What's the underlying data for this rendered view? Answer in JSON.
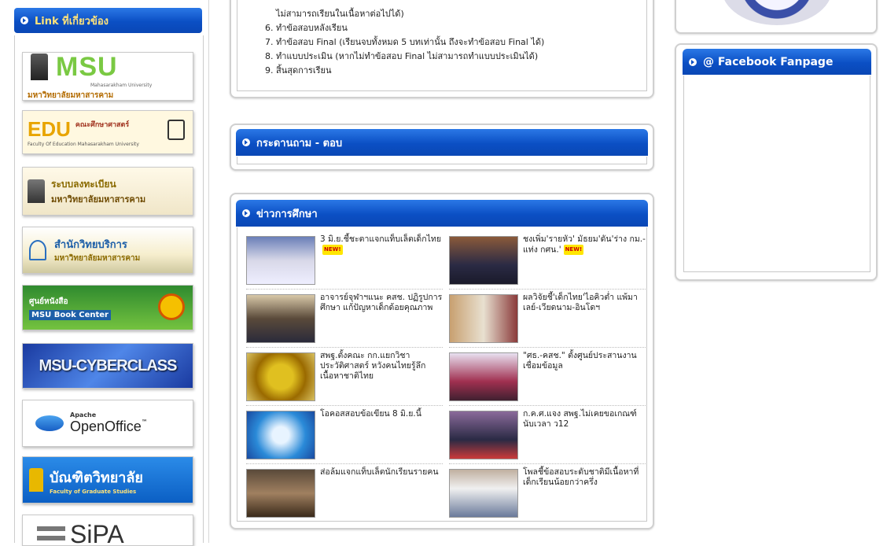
{
  "left": {
    "title": "Link ที่เกี่ยวข้อง",
    "banners": [
      {
        "name": "msu",
        "title": "MSU",
        "sub": "Mahasarakham University",
        "thai": "มหาวิทยาลัยมหาสารคาม"
      },
      {
        "name": "edu",
        "title": "EDU",
        "sub": "Faculty Of Education Mahasarakham University",
        "thai": "คณะศึกษาศาสตร์"
      },
      {
        "name": "registrar",
        "title": "ระบบลงทะเบียน",
        "thai": "มหาวิทยาลัยมหาสารคาม"
      },
      {
        "name": "computer-center",
        "title": "สำนักวิทยบริการ",
        "thai": "มหาวิทยาลัยมหาสารคาม"
      },
      {
        "name": "book-center",
        "title": "ศูนย์หนังสือ",
        "sub": "MSU Book Center"
      },
      {
        "name": "cyberclass",
        "title": "MSU-CYBERCLASS"
      },
      {
        "name": "openoffice",
        "title": "OpenOffice",
        "sub": "Apache",
        "tm": "™"
      },
      {
        "name": "graduate",
        "title": "บัณฑิตวิทยาลัย",
        "sub": "Faculty of Graduate Studies"
      },
      {
        "name": "sipa",
        "title": "SiPA"
      }
    ]
  },
  "steps": {
    "items": [
      "ไม่สามารถเรียนในเนื้อหาต่อไปได้)",
      "6. ทำข้อสอบหลังเรียน",
      "7. ทำข้อสอบ Final (เรียนจบทั้งหมด 5 บทเท่านั้น ถึงจะทำข้อสอบ Final ได้)",
      "8. ทำแบบประเมิน (หากไม่ทำข้อสอบ Final ไม่สามารถทำแบบประเมินได้)",
      "9. สิ้นสุดการเรียน"
    ]
  },
  "qa": {
    "title": "กระดานถาม - ตอบ"
  },
  "news": {
    "title": "ข่าวการศึกษา",
    "badge": "NEW!",
    "items": [
      {
        "text": "3 มิ.ย.ชี้ชะตาแจกแท็บเล็ตเด็กไทย",
        "new": true
      },
      {
        "text": "ชงเพิ่ม'รายหัว' มัธยม'ดัน'ร่าง กม.-แท่ง กศน.'",
        "new": true
      },
      {
        "text": "อาจารย์จุฬาฯแนะ คสช. ปฏิรูปการศึกษา แก้ปัญหาเด็กด้อยคุณภาพ",
        "new": false
      },
      {
        "text": "ผลวิจัยชี้'เด็กไทย'ไอคิวต่ำ แพ้มาเลย์-เวียดนาม-อินโดฯ",
        "new": false
      },
      {
        "text": "สพฐ.ตั้งคณะ กก.แยกวิชาประวัติศาสตร์ หวังคนไทยรู้ลึกเนื้อหาชาติไทย",
        "new": false
      },
      {
        "text": "\"ศธ.-คสช.\" ตั้งศูนย์ประสานงานเชื่อมข้อมูล",
        "new": false
      },
      {
        "text": "โอคอสสอบข้อเขียน 8 มิ.ย.นี้",
        "new": false
      },
      {
        "text": "ก.ค.ศ.แจง สพฐ.ไม่เคยขอเกณฑ์นับเวลา ว12",
        "new": false
      },
      {
        "text": "ส่อล้มแจกแท็บเล็ตนักเรียนรายคน",
        "new": false
      },
      {
        "text": "โพลชี้ข้อสอบระดับชาติมีเนื้อหาที่เด็กเรียนน้อยกว่าครึ่ง",
        "new": false
      }
    ]
  },
  "facebook": {
    "title": "@ Facebook Fanpage"
  },
  "colors": {
    "header_blue": "#0b4fc4",
    "badge_yellow": "#ffe600"
  }
}
